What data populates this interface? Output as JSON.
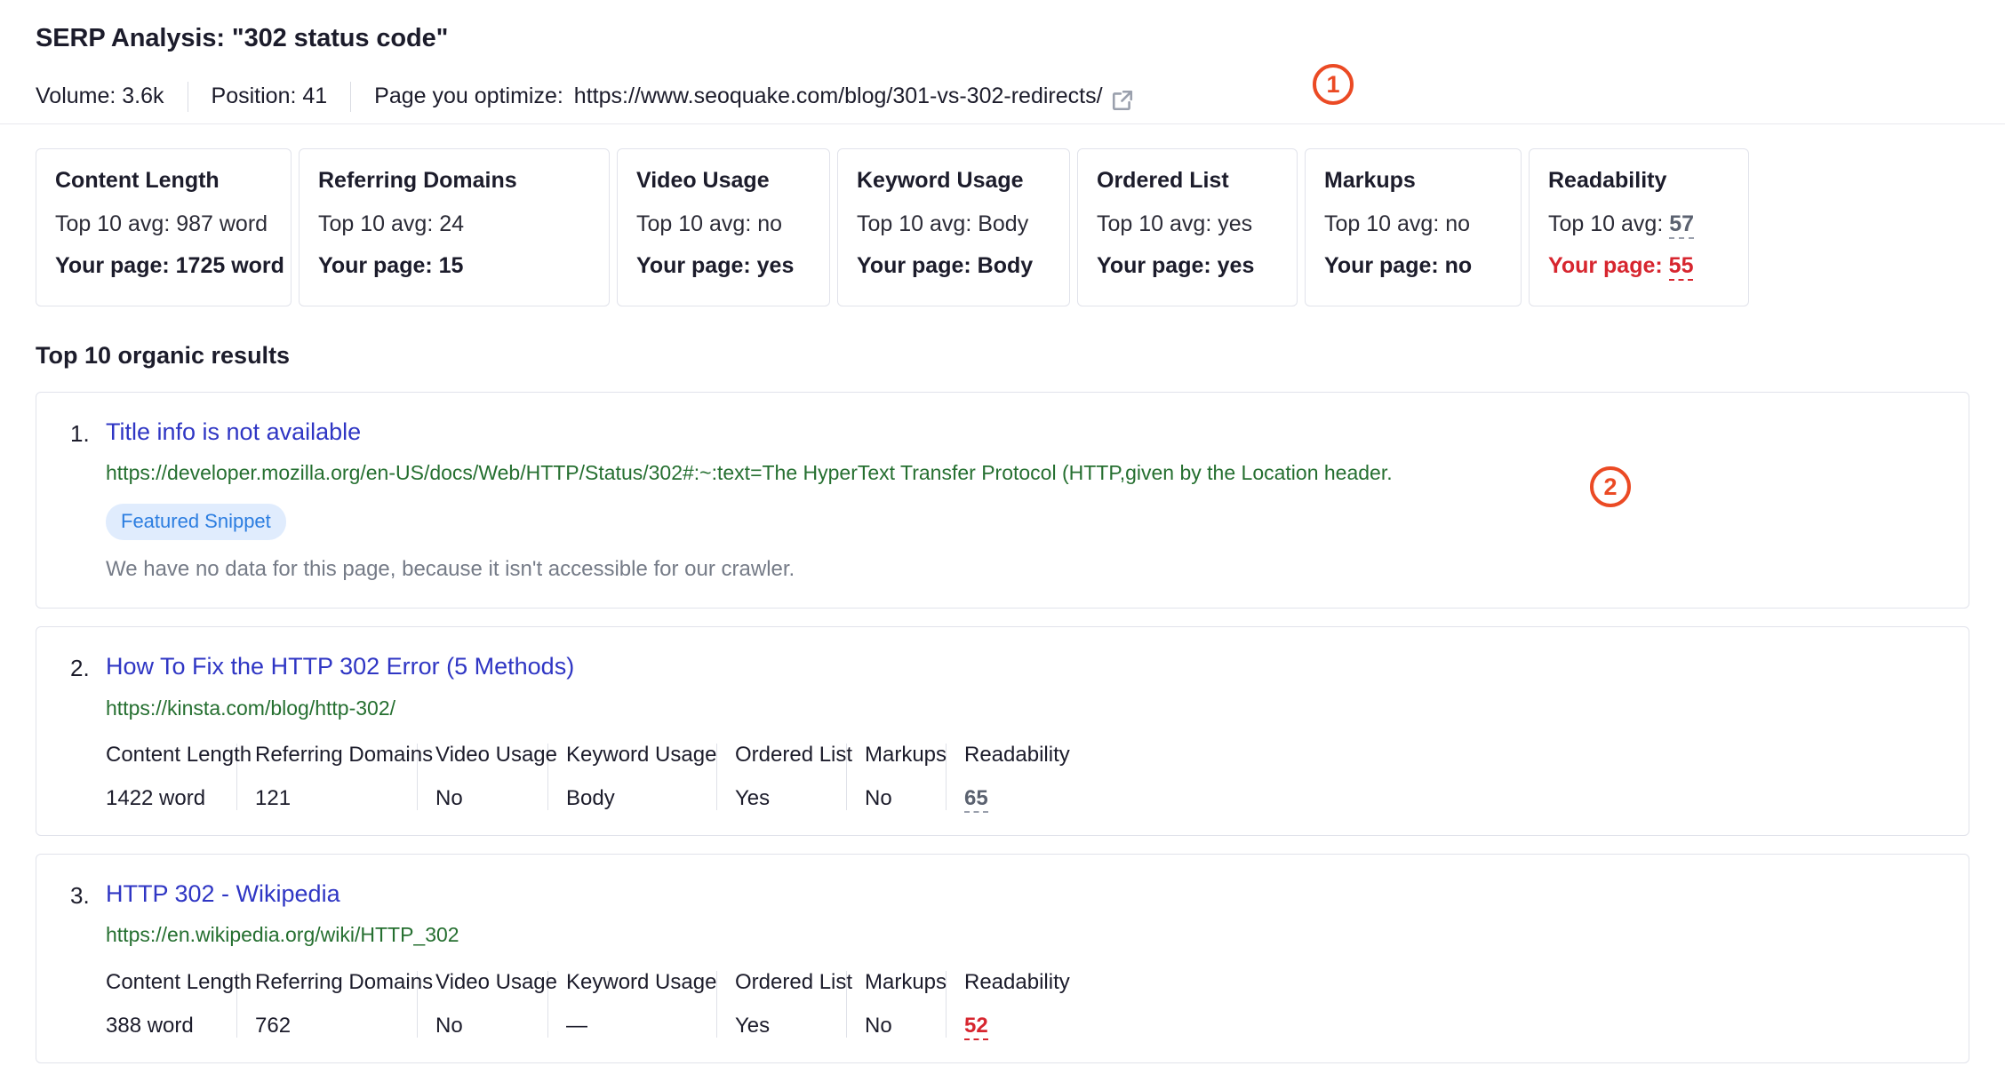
{
  "header": {
    "title": "SERP Analysis: \"302 status code\"",
    "volume": "Volume: 3.6k",
    "position": "Position: 41",
    "page_label": "Page you optimize:",
    "page_url": "https://www.seoquake.com/blog/301-vs-302-redirects/",
    "external_link_icon": "external-link-icon"
  },
  "annotations": [
    {
      "number": "1"
    },
    {
      "number": "2"
    }
  ],
  "metric_cards": [
    {
      "title": "Content Length",
      "avg_label": "Top 10 avg: 987 word",
      "your_label": "Your page: 1725 word",
      "bad": false
    },
    {
      "title": "Referring Domains",
      "avg_label": "Top 10 avg: 24",
      "your_label": "Your page: 15",
      "bad": false
    },
    {
      "title": "Video Usage",
      "avg_label": "Top 10 avg: no",
      "your_label": "Your page: yes",
      "bad": false
    },
    {
      "title": "Keyword Usage",
      "avg_label": "Top 10 avg: Body",
      "your_label": "Your page: Body",
      "bad": false
    },
    {
      "title": "Ordered List",
      "avg_label": "Top 10 avg: yes",
      "your_label": "Your page: yes",
      "bad": false
    },
    {
      "title": "Markups",
      "avg_label": "Top 10 avg: no",
      "your_label": "Your page: no",
      "bad": false
    },
    {
      "title": "Readability",
      "avg_prefix": "Top 10 avg: ",
      "avg_value": "57",
      "your_prefix": "Your page: ",
      "your_value": "55",
      "bad": true
    }
  ],
  "section": {
    "title": "Top 10 organic results"
  },
  "results": [
    {
      "rank": "1.",
      "title": "Title info is not available",
      "url": "https://developer.mozilla.org/en-US/docs/Web/HTTP/Status/302#:~:text=The HyperText Transfer Protocol (HTTP,given by the Location header.",
      "badge": "Featured Snippet",
      "note": "We have no data for this page, because it isn't accessible for our crawler."
    },
    {
      "rank": "2.",
      "title": "How To Fix the HTTP 302 Error (5 Methods)",
      "url": "https://kinsta.com/blog/http-302/",
      "metrics": {
        "headers": [
          "Content Length",
          "Referring Domains",
          "Video Usage",
          "Keyword Usage",
          "Ordered List",
          "Markups",
          "Readability"
        ],
        "values": [
          "1422 word",
          "121",
          "No",
          "Body",
          "Yes",
          "No",
          "65"
        ],
        "readability_bad": false
      }
    },
    {
      "rank": "3.",
      "title": "HTTP 302 - Wikipedia",
      "url": "https://en.wikipedia.org/wiki/HTTP_302",
      "metrics": {
        "headers": [
          "Content Length",
          "Referring Domains",
          "Video Usage",
          "Keyword Usage",
          "Ordered List",
          "Markups",
          "Readability"
        ],
        "values": [
          "388 word",
          "762",
          "No",
          "—",
          "Yes",
          "No",
          "52"
        ],
        "readability_bad": true
      }
    }
  ],
  "colors": {
    "link_blue": "#2f36c4",
    "url_green": "#256f30",
    "bad_red": "#d7262f",
    "annotation_red": "#eb4a24",
    "snippet_badge_bg": "#e0ecfd",
    "snippet_badge_text": "#2b7de0"
  }
}
